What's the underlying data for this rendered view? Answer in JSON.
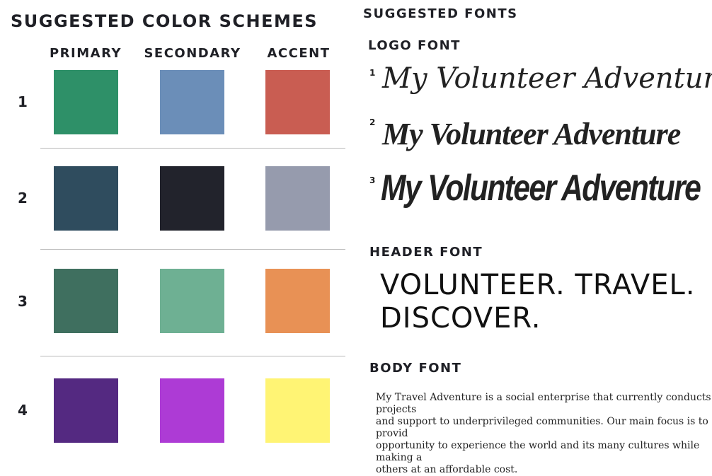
{
  "color_section": {
    "title": "Suggested Color Schemes",
    "columns": [
      "Primary",
      "Secondary",
      "Accent"
    ],
    "rows": [
      {
        "number": "1",
        "colors": [
          "#2e9068",
          "#6b8eb8",
          "#c95d52"
        ]
      },
      {
        "number": "2",
        "colors": [
          "#2f4c5e",
          "#22232c",
          "#969bad"
        ]
      },
      {
        "number": "3",
        "colors": [
          "#3f6f5f",
          "#6eb093",
          "#e89155"
        ]
      },
      {
        "number": "4",
        "colors": [
          "#542981",
          "#ad3bd5",
          "#fff474"
        ]
      }
    ]
  },
  "fonts_section": {
    "title": "Suggested Fonts",
    "logo": {
      "heading": "Logo Font",
      "samples": [
        {
          "number": "1",
          "text": "My Volunteer Adventure"
        },
        {
          "number": "2",
          "text": "My Volunteer Adventure"
        },
        {
          "number": "3",
          "text": "My Volunteer Adventure"
        }
      ]
    },
    "header": {
      "heading": "Header Font",
      "sample": "VOLUNTEER.  TRAVEL.\nDISCOVER."
    },
    "body": {
      "heading": "Body Font",
      "sample": "My Travel Adventure is a social enterprise that currently conducts projects\nand support to underprivileged communities.  Our main focus is to provid\nopportunity to experience the world and its many cultures while making a\nothers at an affordable cost."
    }
  }
}
